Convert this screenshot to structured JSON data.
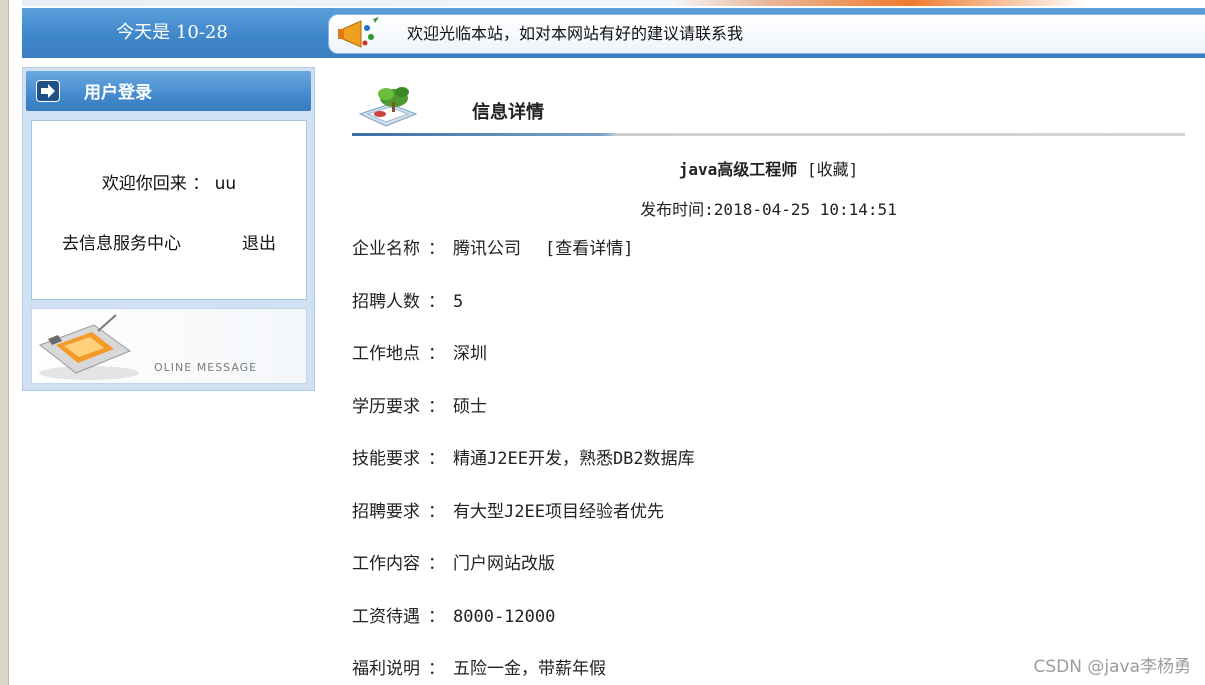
{
  "header": {
    "date_text": "今天是 10-28",
    "notice": "欢迎光临本站，如对本网站有好的建议请联系我"
  },
  "login_panel": {
    "title": "用户登录",
    "welcome_prefix": "欢迎你回来 ：",
    "username": "uu",
    "service_center_link": "去信息服务中心",
    "logout_link": "退出",
    "message_label": "OLINE MESSAGE"
  },
  "content": {
    "section_title": "信息详情",
    "job_title": "java高级工程师",
    "favorite_link": "[收藏]",
    "publish_label": "发布时间:",
    "publish_time": "2018-04-25 10:14:51",
    "fields": [
      {
        "label": "企业名称",
        "value": "腾讯公司",
        "link": "[查看详情]"
      },
      {
        "label": "招聘人数",
        "value": "5"
      },
      {
        "label": "工作地点",
        "value": "深圳"
      },
      {
        "label": "学历要求",
        "value": "硕士"
      },
      {
        "label": "技能要求",
        "value": "精通J2EE开发，熟悉DB2数据库"
      },
      {
        "label": "招聘要求",
        "value": "有大型J2EE项目经验者优先"
      },
      {
        "label": "工作内容",
        "value": "门户网站改版"
      },
      {
        "label": "工资待遇",
        "value": "8000-12000"
      },
      {
        "label": "福利说明",
        "value": "五险一金，带薪年假"
      }
    ],
    "separator": "："
  },
  "watermark": "CSDN @java李杨勇",
  "colors": {
    "header_blue": "#3f86c9",
    "panel_blue": "#cfe1f3"
  }
}
